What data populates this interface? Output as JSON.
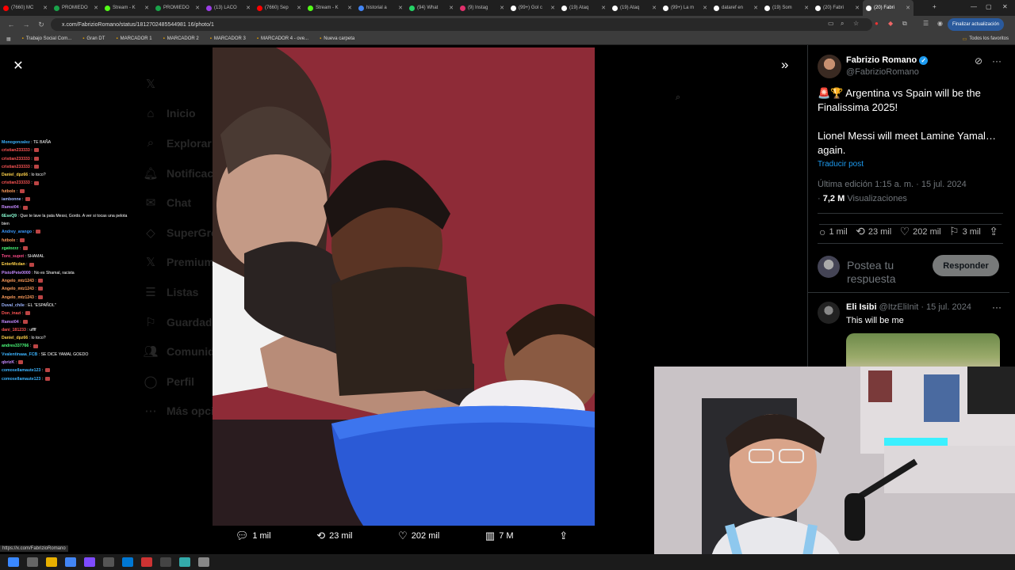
{
  "browser": {
    "tabs": [
      {
        "label": "(7660) MC",
        "color": "#ff0000"
      },
      {
        "label": "PROMIEDO",
        "color": "#1aa34a"
      },
      {
        "label": "Stream - K",
        "color": "#53fc18"
      },
      {
        "label": "PROMIEDO",
        "color": "#1aa34a"
      },
      {
        "label": "(13) LACO",
        "color": "#9b3ee6"
      },
      {
        "label": "(7660) Sep",
        "color": "#ff0000"
      },
      {
        "label": "Stream - K",
        "color": "#53fc18"
      },
      {
        "label": "historial a",
        "color": "#4285f4"
      },
      {
        "label": "(94) What",
        "color": "#25d366"
      },
      {
        "label": "(9) Instag",
        "color": "#e1306c"
      },
      {
        "label": "(99+) Gol c",
        "color": "#ffffff"
      },
      {
        "label": "(19) Ataq",
        "color": "#ffffff"
      },
      {
        "label": "(19) Ataq",
        "color": "#ffffff"
      },
      {
        "label": "(99+) La m",
        "color": "#ffffff"
      },
      {
        "label": "dataref en",
        "color": "#ffffff"
      },
      {
        "label": "(19) Som",
        "color": "#ffffff"
      },
      {
        "label": "(20) Fabri",
        "color": "#ffffff"
      },
      {
        "label": "(20) Fabri",
        "color": "#ffffff",
        "active": true
      }
    ],
    "url": "x.com/FabrizioRomano/status/1812702485544981 16/photo/1",
    "update_button": "Finalizar actualización",
    "bookmarks": [
      "Trabajo Social Com...",
      "Gran DT",
      "MARCADOR 1",
      "MARCADOR 2",
      "MARCADOR 3",
      "MARCADOR 4 - ove...",
      "Nueva carpeta"
    ],
    "all_favorites": "Todos los favoritos",
    "status_url": "https://x.com/FabrizioRomano"
  },
  "x_nav": [
    "Inicio",
    "Explorar",
    "Notificaciones",
    "Chat",
    "SuperGrok",
    "Premium",
    "Listas",
    "Guardados",
    "Comunidades",
    "Perfil",
    "Más opciones"
  ],
  "chat": [
    {
      "user": "Monogonzalez",
      "color": "#3cb4ff",
      "msg": "TE BAÑA"
    },
    {
      "user": "cristian233333",
      "color": "#ff5555",
      "msg": ""
    },
    {
      "user": "cristian233333",
      "color": "#ff5555",
      "msg": ""
    },
    {
      "user": "cristian233333",
      "color": "#ff5555",
      "msg": ""
    },
    {
      "user": "Daniel_dpz66",
      "color": "#ffd24a",
      "msg": "lo toco?"
    },
    {
      "user": "cristian233333",
      "color": "#ff5555",
      "msg": ""
    },
    {
      "user": "futbolx",
      "color": "#ff9d5c",
      "msg": ""
    },
    {
      "user": "iambonne",
      "color": "#9db5ff",
      "msg": ""
    },
    {
      "user": "Ramst04",
      "color": "#c48aff",
      "msg": ""
    },
    {
      "user": "6EseQ9",
      "color": "#8affd5",
      "msg": "Que te lave la pata Messi, Gordo. A ver si tocas una pelota bien"
    },
    {
      "user": "Andrey_arango",
      "color": "#3c9bff",
      "msg": ""
    },
    {
      "user": "futbolx",
      "color": "#ff9d5c",
      "msg": ""
    },
    {
      "user": "zgatozzz",
      "color": "#4cff7c",
      "msg": ""
    },
    {
      "user": "Toro_supot",
      "color": "#ff4c8a",
      "msg": "SHAMAL"
    },
    {
      "user": "EnterMcdan",
      "color": "#ffd24a",
      "msg": ""
    },
    {
      "user": "PistolPete0000",
      "color": "#c48aff",
      "msg": "No es Shamal, racista"
    },
    {
      "user": "Angelo_mtz1243",
      "color": "#ff9d5c",
      "msg": ""
    },
    {
      "user": "Angelo_mtz1243",
      "color": "#ff9d5c",
      "msg": ""
    },
    {
      "user": "Angelo_mtz1243",
      "color": "#ff9d5c",
      "msg": ""
    },
    {
      "user": "Duval_chile",
      "color": "#9db5ff",
      "msg": "EL \"ESPAÑOL\""
    },
    {
      "user": "Don_inazi",
      "color": "#ff5555",
      "msg": ""
    },
    {
      "user": "Ramst04",
      "color": "#c48aff",
      "msg": ""
    },
    {
      "user": "dani_181233",
      "color": "#ff5555",
      "msg": "uffff"
    },
    {
      "user": "Daniel_dpz66",
      "color": "#ffd24a",
      "msg": "lo toco?"
    },
    {
      "user": "andres337766",
      "color": "#4cff7c",
      "msg": ""
    },
    {
      "user": "Vvalentinaaa_FCB",
      "color": "#3cb4ff",
      "msg": "SE DICE YAMAL GOEDO"
    },
    {
      "user": "qbrizK",
      "color": "#c48aff",
      "msg": ""
    },
    {
      "user": "comosellamaute123",
      "color": "#3cb4ff",
      "msg": ""
    },
    {
      "user": "comosellamaute123",
      "color": "#3cb4ff",
      "msg": ""
    }
  ],
  "photo_actions": {
    "replies": "1 mil",
    "retweets": "23 mil",
    "likes": "202 mil",
    "views": "7 M"
  },
  "post": {
    "name": "Fabrizio Romano",
    "handle": "@FabrizioRomano",
    "text1": "🚨🏆 Argentina vs Spain will be the Finalissima 2025!",
    "text2": "Lionel Messi will meet Lamine Yamal… again.",
    "translate": "Traducir post",
    "edited": "Última edición 1:15 a. m. · 15 jul. 2024",
    "views_num": "7,2 M",
    "views_label": "Visualizaciones",
    "stats": {
      "replies": "1 mil",
      "retweets": "23 mil",
      "likes": "202 mil",
      "bookmarks": "3 mil"
    },
    "reply_placeholder": "Postea tu respuesta",
    "reply_button": "Responder"
  },
  "reply": {
    "name": "Eli Isibi",
    "handle": "@ItzEliInit",
    "date": "· 15 jul. 2024",
    "text": "This will be me"
  },
  "colors": {
    "accent": "#1d9bf0",
    "bg": "#000000"
  }
}
